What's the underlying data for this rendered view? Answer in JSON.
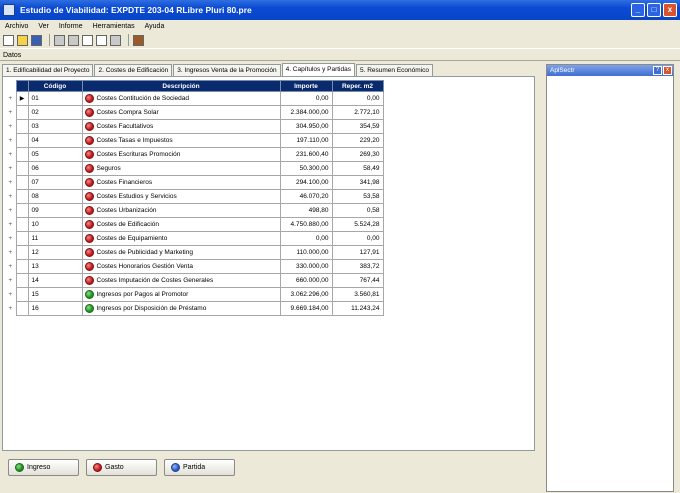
{
  "window": {
    "title": "Estudio de Viabilidad: EXPDTE 203-04 RLibre Pluri 80.pre"
  },
  "window_buttons": {
    "minimize": "_",
    "maximize": "□",
    "close": "x"
  },
  "menu": [
    "Archivo",
    "Ver",
    "Informe",
    "Herramientas",
    "Ayuda"
  ],
  "datos_label": "Datos",
  "tabs": [
    "1. Edificabilidad del Proyecto",
    "2. Costes de Edificación",
    "3. Ingresos Venta de la Promoción",
    "4. Capítulos y Partidas",
    "5. Resumen Económico"
  ],
  "active_tab": 3,
  "table": {
    "headers": [
      "Código",
      "Descripción",
      "Importe",
      "Reper. m2"
    ],
    "rows": [
      {
        "expand": "+",
        "code": "01",
        "desc": "Costes Contitución de Sociedad",
        "importe": "0,00",
        "m2": "0,00",
        "type": "gasto",
        "selected": true
      },
      {
        "expand": "+",
        "code": "02",
        "desc": "Costes Compra Solar",
        "importe": "2.384.000,00",
        "m2": "2.772,10",
        "type": "gasto"
      },
      {
        "expand": "+",
        "code": "03",
        "desc": "Costes Facultativos",
        "importe": "304.950,00",
        "m2": "354,59",
        "type": "gasto"
      },
      {
        "expand": "+",
        "code": "04",
        "desc": "Costes Tasas e Impuestos",
        "importe": "197.110,00",
        "m2": "229,20",
        "type": "gasto"
      },
      {
        "expand": "+",
        "code": "05",
        "desc": "Costes Escrituras Promoción",
        "importe": "231.600,40",
        "m2": "269,30",
        "type": "gasto"
      },
      {
        "expand": "+",
        "code": "06",
        "desc": "Seguros",
        "importe": "50.300,00",
        "m2": "58,49",
        "type": "gasto"
      },
      {
        "expand": "+",
        "code": "07",
        "desc": "Costes Financieros",
        "importe": "294.100,00",
        "m2": "341,98",
        "type": "gasto"
      },
      {
        "expand": "+",
        "code": "08",
        "desc": "Costes Estudios y Servicios",
        "importe": "46.070,20",
        "m2": "53,58",
        "type": "gasto"
      },
      {
        "expand": "+",
        "code": "09",
        "desc": "Costes Urbanización",
        "importe": "498,80",
        "m2": "0,58",
        "type": "gasto"
      },
      {
        "expand": "+",
        "code": "10",
        "desc": "Costes de Edificación",
        "importe": "4.750.880,00",
        "m2": "5.524,28",
        "type": "gasto"
      },
      {
        "expand": "+",
        "code": "11",
        "desc": "Costes de Equipamiento",
        "importe": "0,00",
        "m2": "0,00",
        "type": "gasto"
      },
      {
        "expand": "+",
        "code": "12",
        "desc": "Costes de Publicidad y Marketing",
        "importe": "110.000,00",
        "m2": "127,91",
        "type": "gasto"
      },
      {
        "expand": "+",
        "code": "13",
        "desc": "Costes Honorarios Gestión Venta",
        "importe": "330.000,00",
        "m2": "383,72",
        "type": "gasto"
      },
      {
        "expand": "+",
        "code": "14",
        "desc": "Costes Imputación de Costes Generales",
        "importe": "660.000,00",
        "m2": "767,44",
        "type": "gasto"
      },
      {
        "expand": "+",
        "code": "15",
        "desc": "Ingresos por Pagos al Promotor",
        "importe": "3.062.296,00",
        "m2": "3.560,81",
        "type": "ingreso"
      },
      {
        "expand": "+",
        "code": "16",
        "desc": "Ingresos por Disposición de Préstamo",
        "importe": "9.669.184,00",
        "m2": "11.243,24",
        "type": "ingreso"
      }
    ]
  },
  "buttons": {
    "ingreso": "Ingreso",
    "gasto": "Gasto",
    "partida": "Partida"
  },
  "side_panel": {
    "title": "AplSectr",
    "buttons": [
      "?",
      "x"
    ]
  }
}
